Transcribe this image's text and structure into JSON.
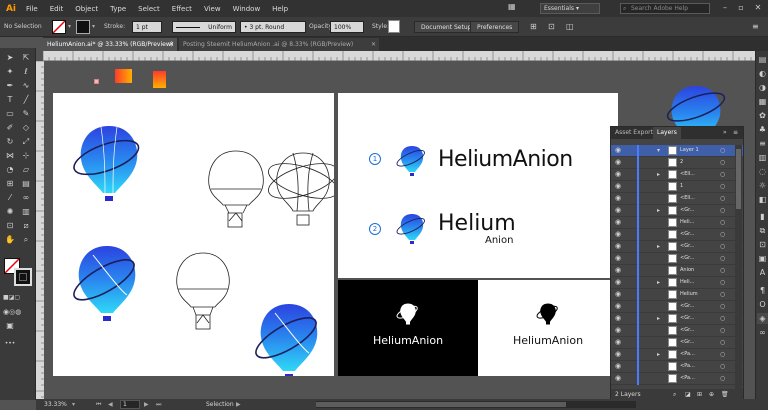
{
  "app": {
    "logo": "Ai"
  },
  "menu": [
    "File",
    "Edit",
    "Object",
    "Type",
    "Select",
    "Effect",
    "View",
    "Window",
    "Help"
  ],
  "workspace": "Essentials",
  "search_placeholder": "Search Adobe Help",
  "control": {
    "selection": "No Selection",
    "stroke_label": "Stroke:",
    "stroke_value": "1 pt",
    "profile": "Uniform",
    "brush": "3 pt. Round",
    "opacity_label": "Opacity:",
    "opacity_value": "100%",
    "style_label": "Style:",
    "doc_setup": "Document Setup",
    "preferences": "Preferences"
  },
  "tabs": [
    "HeliumAnion.ai* @ 33.33% (RGB/Preview)",
    "Posting Steemit HeliumAnion .ai @ 8.33% (RGB/Preview)"
  ],
  "artwork": {
    "option1": "1",
    "option2": "2",
    "brand_full": "HeliumAnion",
    "brand_top": "Helium",
    "brand_sub": "Anion",
    "brand_black_bg": "HeliumAnion",
    "brand_white_bg": "HeliumAnion"
  },
  "layers_panel": {
    "tab_asset": "Asset Export",
    "tab_layers": "Layers",
    "rows": [
      "Layer 1",
      "2",
      "<Ell...",
      "1",
      "<Ell...",
      "<Gr...",
      "Heli...",
      "<Gr...",
      "<Gr...",
      "<Gr...",
      "Anion",
      "Heli...",
      "Helium",
      "<Gr...",
      "<Gr...",
      "<Gr...",
      "<Gr...",
      "<Pa...",
      "<Pa...",
      "<Pa..."
    ],
    "footer": "2 Layers"
  },
  "status": {
    "zoom": "33.33%",
    "page": "1",
    "tool": "Selection"
  },
  "colors": {
    "balloon_top": "#2b58e6",
    "balloon_bottom": "#2fd3f5",
    "basket": "#2a2ad0",
    "orbit": "#1b1f5c",
    "accent_orange": "#ff7a2a"
  }
}
